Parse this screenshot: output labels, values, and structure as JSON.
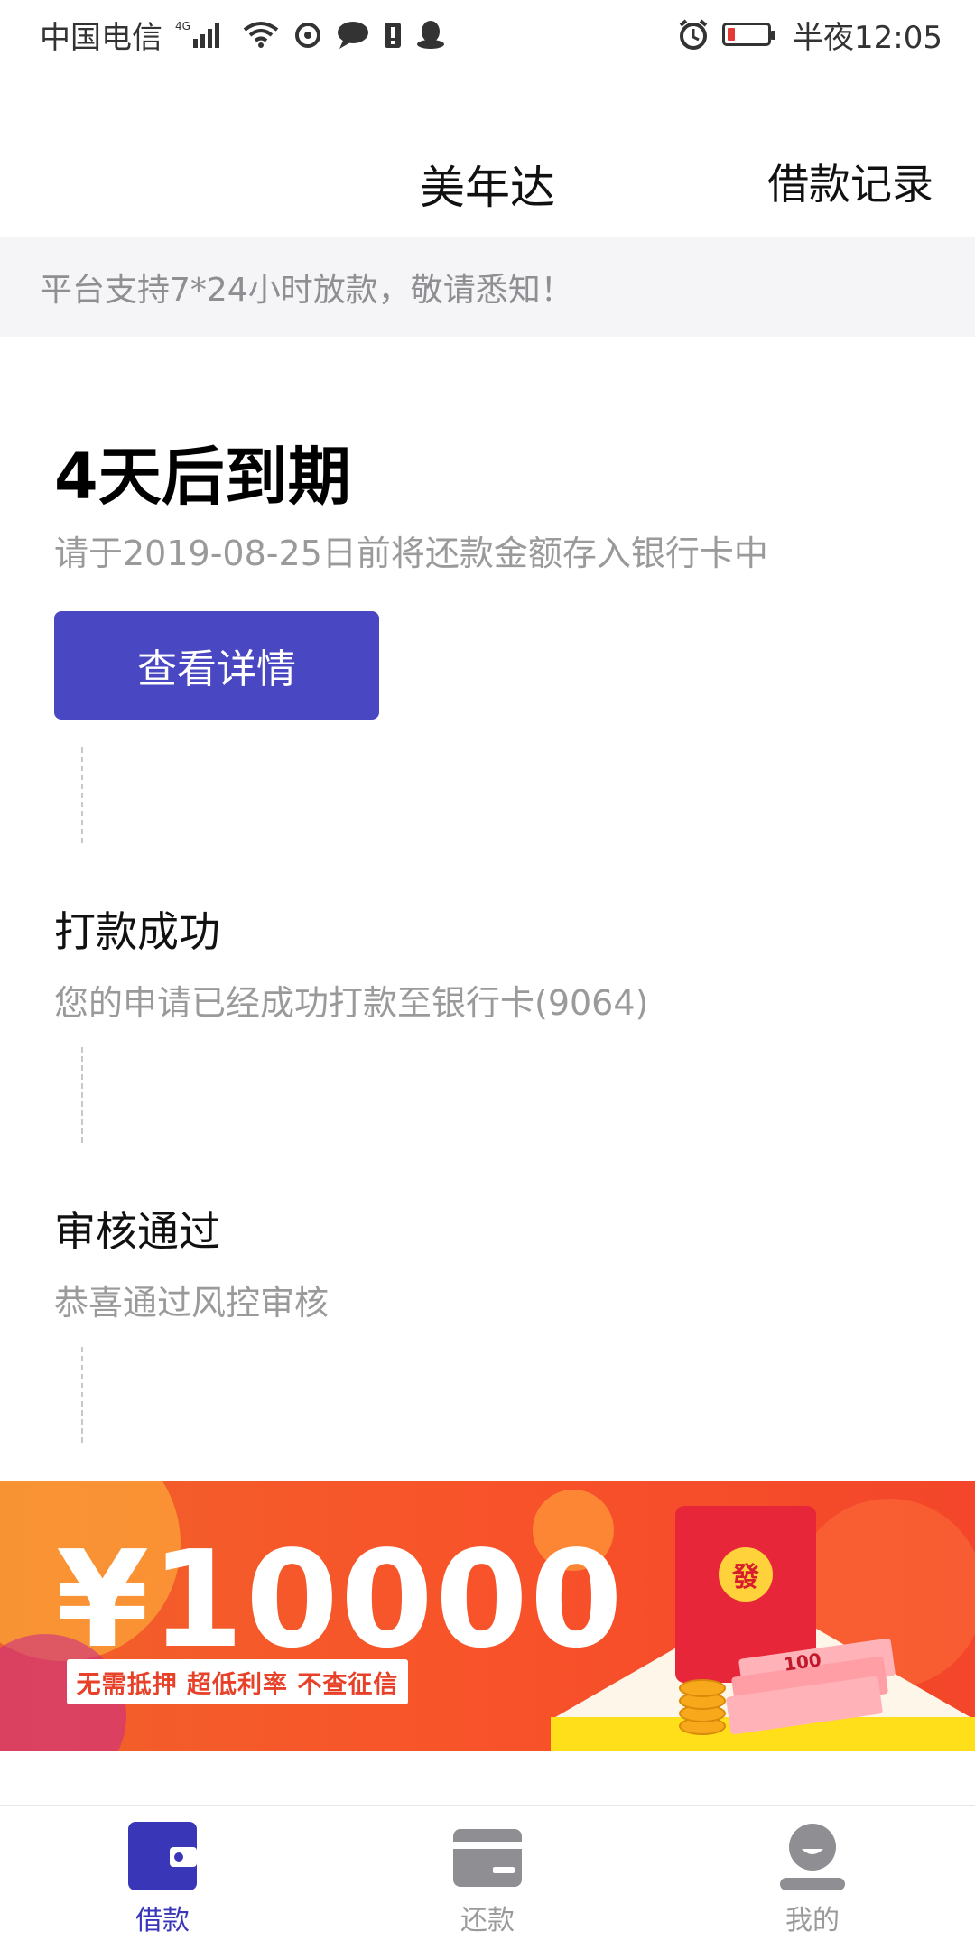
{
  "status_bar": {
    "carrier": "中国电信",
    "network": "4G",
    "time": "半夜12:05"
  },
  "header": {
    "title": "美年达",
    "records_link": "借款记录"
  },
  "notice": {
    "text": "平台支持7*24小时放款，敬请悉知！"
  },
  "loan_status": {
    "due_title": "4天后到期",
    "due_subtitle": "请于2019-08-25日前将还款金额存入银行卡中",
    "detail_button": "查看详情"
  },
  "timeline": [
    {
      "title": "打款成功",
      "subtitle": "您的申请已经成功打款至银行卡(9064)"
    },
    {
      "title": "审核通过",
      "subtitle": "恭喜通过风控审核"
    }
  ],
  "banner": {
    "amount": "¥10000",
    "tagline": "无需抵押  超低利率  不查征信",
    "seal_char": "發",
    "cash_label": "100"
  },
  "tab_bar": {
    "tabs": [
      {
        "label": "借款",
        "icon": "wallet-icon",
        "active": true
      },
      {
        "label": "还款",
        "icon": "card-icon",
        "active": false
      },
      {
        "label": "我的",
        "icon": "profile-icon",
        "active": false
      }
    ]
  },
  "colors": {
    "accent": "#4a47c2",
    "battery_low": "#e53935",
    "banner_orange": "#f8542a"
  }
}
